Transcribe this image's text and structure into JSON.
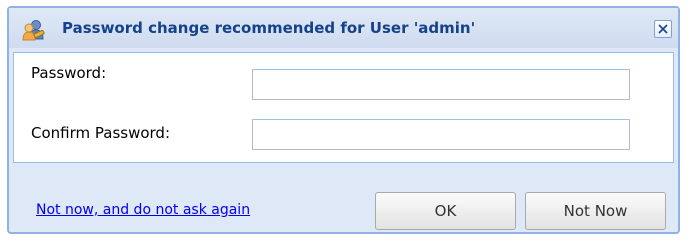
{
  "dialog": {
    "title": "Password change recommended for User 'admin'",
    "title_icon": "users-key-icon",
    "close_icon": "close-icon"
  },
  "form": {
    "password_label": "Password:",
    "password_value": "",
    "confirm_label": "Confirm Password:",
    "confirm_value": ""
  },
  "footer": {
    "dont_ask_link": "Not now, and do not ask again",
    "ok_label": "OK",
    "not_now_label": "Not Now"
  },
  "colors": {
    "title_text": "#15428b",
    "dialog_bg": "#dfe8f6",
    "link": "#0000ee"
  }
}
